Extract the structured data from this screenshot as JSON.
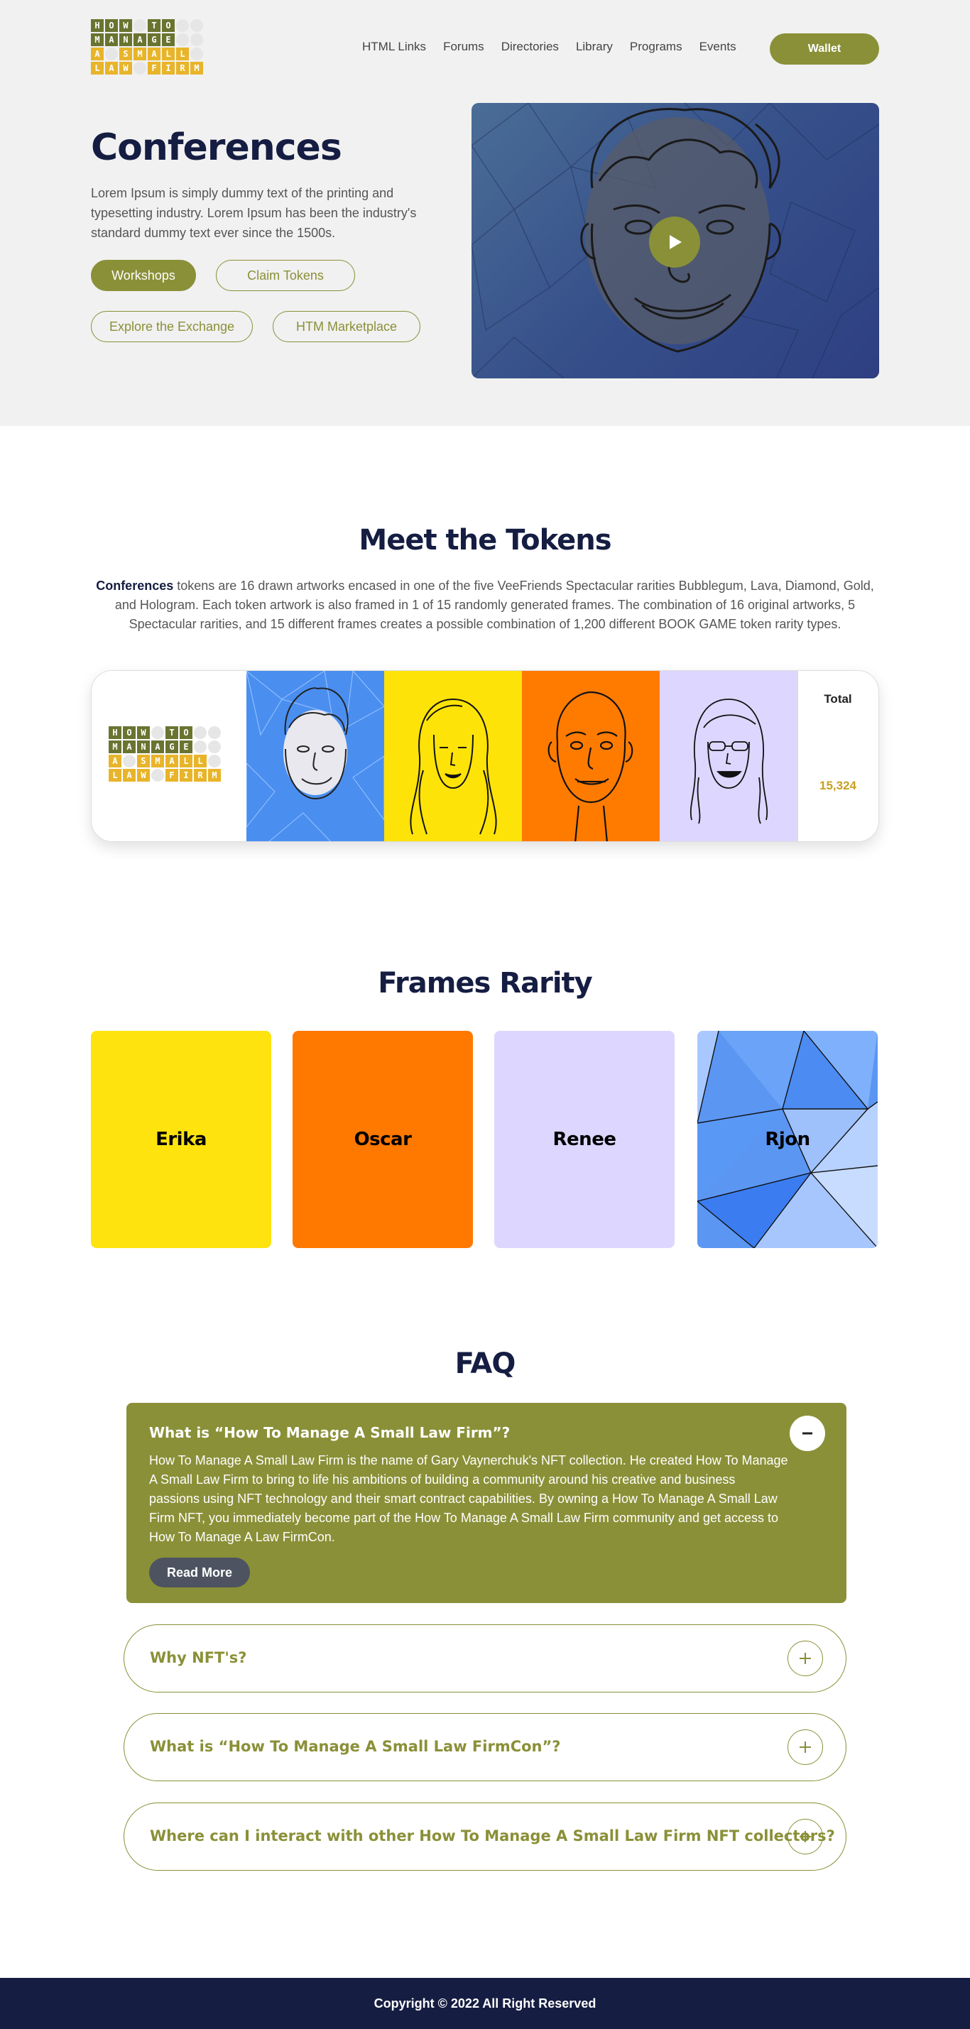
{
  "logo": {
    "rows": [
      [
        "H",
        "O",
        "W",
        "",
        "T",
        "O"
      ],
      [
        "M",
        "A",
        "N",
        "A",
        "G",
        "E"
      ],
      [
        "A",
        "",
        "S",
        "M",
        "A",
        "L",
        "L"
      ],
      [
        "L",
        "A",
        "W",
        "",
        "F",
        "I",
        "R",
        "M"
      ]
    ]
  },
  "nav": {
    "items": [
      "HTML Links",
      "Forums",
      "Directories",
      "Library",
      "Programs",
      "Events"
    ],
    "wallet_label": "Wallet"
  },
  "hero": {
    "title": "Conferences",
    "description": "Lorem Ipsum is simply dummy text of the printing and typesetting industry. Lorem Ipsum has been the industry's standard dummy text ever since the 1500s.",
    "buttons": {
      "workshops": "Workshops",
      "claim_tokens": "Claim Tokens",
      "explore_exchange": "Explore the Exchange",
      "htm_marketplace": "HTM Marketplace"
    }
  },
  "tokens": {
    "title": "Meet the Tokens",
    "desc_bold": "Conferences",
    "desc_rest": " tokens are 16 drawn artworks encased in one of the five VeeFriends Spectacular rarities Bubblegum, Lava, Diamond, Gold, and Hologram. Each token artwork is also framed in 1 of 15 randomly generated frames. The combination of 16 original artworks, 5 Spectacular rarities, and 15 different frames creates a possible combination of 1,200 different BOOK GAME token rarity types.",
    "total_label": "Total",
    "total_value": "15,324",
    "colors": [
      "#4a8ff0",
      "#fde308",
      "#ff7b00",
      "#ddd6fe"
    ]
  },
  "frames": {
    "title": "Frames Rarity",
    "items": [
      {
        "name": "Erika",
        "color": "#fee30f"
      },
      {
        "name": "Oscar",
        "color": "#ff7800"
      },
      {
        "name": "Renee",
        "color": "#ddd6fe"
      },
      {
        "name": "Rjon",
        "color": "#5b96f3"
      }
    ]
  },
  "faq": {
    "title": "FAQ",
    "open": {
      "question": "What is “How To Manage A Small Law Firm”?",
      "answer": "How To Manage A Small Law Firm is the name of Gary Vaynerchuk's NFT collection. He created How To Manage A Small Law Firm to bring to life his ambitions of building a community around his creative and business passions using NFT technology and their smart contract capabilities. By owning a How To Manage A Small Law Firm NFT, you immediately become part of the How To Manage A Small Law Firm community and get access to How To Manage A Law FirmCon.",
      "read_more": "Read More"
    },
    "closed": [
      "Why NFT's?",
      "What is “How To Manage A Small Law FirmCon”?",
      "Where can I interact with other How To Manage A Small Law Firm NFT collectors?"
    ]
  },
  "footer": {
    "copyright": "Copyright © 2022 All Right Reserved"
  }
}
